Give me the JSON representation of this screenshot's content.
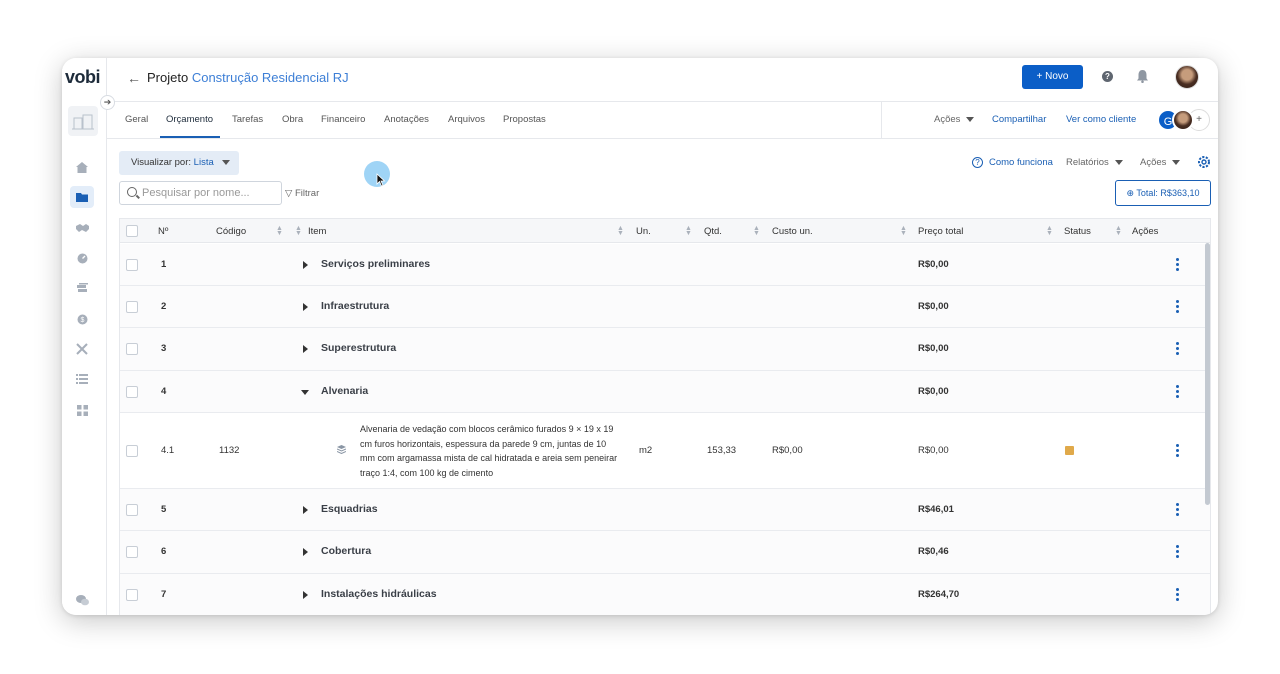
{
  "app": {
    "logo": "vobi"
  },
  "header": {
    "title_prefix": "Projeto",
    "project_name": "Construção Residencial RJ",
    "new_button": "+ Novo",
    "help": "?"
  },
  "tabs": [
    "Geral",
    "Orçamento",
    "Tarefas",
    "Obra",
    "Financeiro",
    "Anotações",
    "Arquivos",
    "Propostas"
  ],
  "tab_actions": {
    "acoes": "Ações",
    "share": "Compartilhar",
    "client_view": "Ver como cliente",
    "user_initial": "G",
    "more": "+"
  },
  "toolbar": {
    "view_label": "Visualizar por:",
    "view_value": "Lista",
    "how_it_works": "Como funciona",
    "reports": "Relatórios",
    "actions": "Ações",
    "search_placeholder": "Pesquisar por nome...",
    "filter": "Filtrar",
    "total": "Total: R$363,10"
  },
  "table": {
    "headers": [
      "Nº",
      "Código",
      "Item",
      "Un.",
      "Qtd.",
      "Custo un.",
      "Preço total",
      "Status",
      "Ações"
    ],
    "rows": [
      {
        "n": "1",
        "name": "Serviços preliminares",
        "total": "R$0,00"
      },
      {
        "n": "2",
        "name": "Infraestrutura",
        "total": "R$0,00"
      },
      {
        "n": "3",
        "name": "Superestrutura",
        "total": "R$0,00"
      },
      {
        "n": "4",
        "name": "Alvenaria",
        "total": "R$0,00"
      },
      {
        "n": "4.1",
        "code": "1132",
        "desc": "Alvenaria de vedação com blocos cerâmico furados 9 × 19 x 19 cm furos horizontais, espessura da parede 9 cm, juntas de 10 mm com argamassa mista de cal hidratada e areia sem peneirar traço 1:4, com 100 kg de cimento",
        "unit": "m2",
        "qty": "153,33",
        "unit_cost": "R$0,00",
        "total": "R$0,00"
      },
      {
        "n": "5",
        "name": "Esquadrias",
        "total": "R$46,01"
      },
      {
        "n": "6",
        "name": "Cobertura",
        "total": "R$0,46"
      },
      {
        "n": "7",
        "name": "Instalações hidráulicas",
        "total": "R$264,70"
      }
    ]
  },
  "colors": {
    "accent": "#1a5fb4",
    "primary_button": "#0b5ec7",
    "status_pending": "#e0a94a"
  }
}
